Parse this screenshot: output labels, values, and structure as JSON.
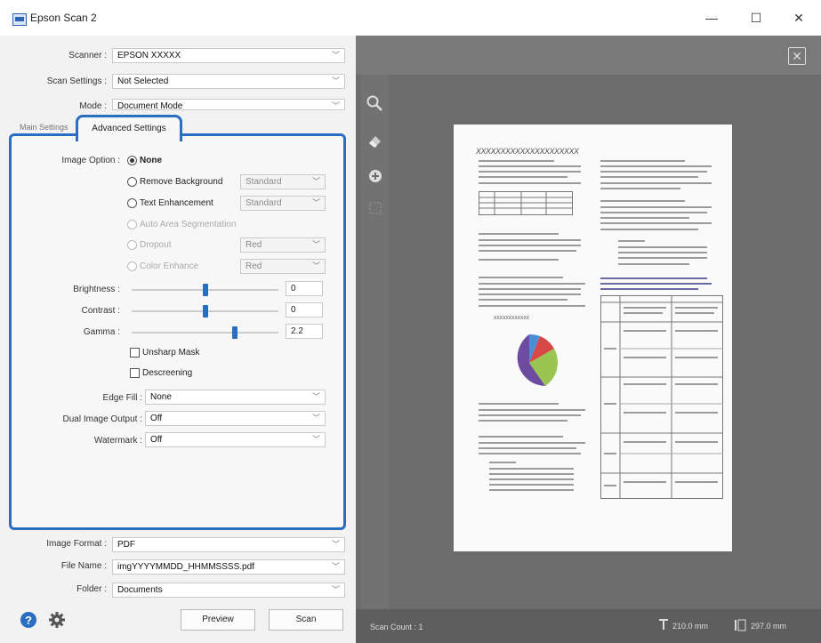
{
  "window": {
    "title": "Epson Scan 2",
    "controls": [
      "—",
      "☐",
      "✕"
    ]
  },
  "settings": {
    "scanner_label": "Scanner :",
    "scanner_value": "EPSON XXXXX",
    "scan_settings_label": "Scan Settings :",
    "scan_settings_value": "Not Selected",
    "mode_label": "Mode :",
    "mode_value": "Document Mode"
  },
  "tabs": {
    "main": "Main Settings",
    "advanced": "Advanced Settings"
  },
  "advanced": {
    "image_option_label": "Image Option :",
    "options": {
      "none": "None",
      "remove_background": "Remove Background",
      "remove_background_value": "Standard",
      "text_enhancement": "Text Enhancement",
      "text_enhancement_value": "Standard",
      "auto_area": "Auto Area Segmentation",
      "dropout": "Dropout",
      "dropout_value": "Red",
      "color_enhance": "Color Enhance",
      "color_enhance_value": "Red"
    },
    "brightness_label": "Brightness :",
    "brightness_value": "0",
    "brightness_level": 0.5,
    "contrast_label": "Contrast :",
    "contrast_value": "0",
    "contrast_level": 0.5,
    "gamma_label": "Gamma :",
    "gamma_value": "2.2",
    "gamma_level": 0.7,
    "unsharp_mask": "Unsharp Mask",
    "descreening": "Descreening",
    "edge_fill_label": "Edge Fill :",
    "edge_fill_value": "None",
    "dual_image_label": "Dual Image Output :",
    "dual_image_value": "Off",
    "watermark_label": "Watermark :",
    "watermark_value": "Off"
  },
  "output": {
    "image_format_label": "Image Format :",
    "image_format_value": "PDF",
    "file_name_label": "File Name :",
    "file_name_value": "imgYYYYMMDD_HHMMSSSS.pdf",
    "folder_label": "Folder :",
    "folder_value": "Documents"
  },
  "buttons": {
    "preview": "Preview",
    "scan": "Scan"
  },
  "status": {
    "scan_count": "Scan Count : 1",
    "width": "210.0 mm",
    "height": "297.0 mm"
  },
  "document": {
    "heading": "XXXXXXXXXXXXXXXXXXXXX",
    "pie_label": "XXXXXXXXXXXX"
  },
  "colors": {
    "accent": "#2a6ec2",
    "preview_bg": "#6c6c6c",
    "pie": [
      "#6d4c9f",
      "#9bc552",
      "#d94848",
      "#4a8fd6"
    ]
  }
}
